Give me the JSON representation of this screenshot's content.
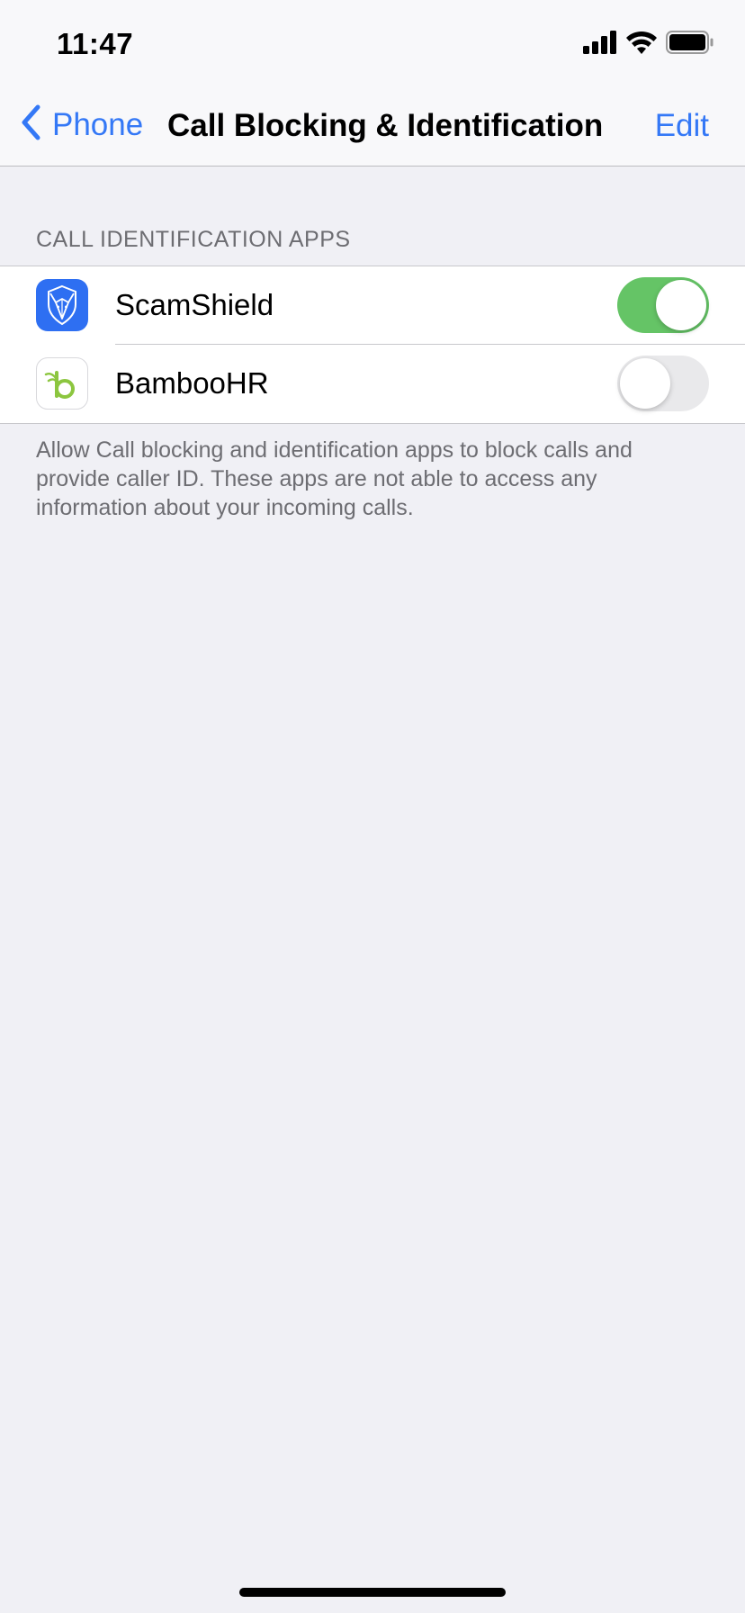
{
  "status_bar": {
    "time": "11:47"
  },
  "nav": {
    "back_label": "Phone",
    "title": "Call Blocking & Identification",
    "edit_label": "Edit"
  },
  "section": {
    "header": "CALL IDENTIFICATION APPS",
    "items": [
      {
        "label": "ScamShield",
        "icon": "scamshield-app-icon",
        "enabled": true
      },
      {
        "label": "BambooHR",
        "icon": "bamboohr-app-icon",
        "enabled": false
      }
    ],
    "footer": "Allow Call blocking and identification apps to block calls and provide caller ID. These apps are not able to access any information about your incoming calls."
  },
  "colors": {
    "accent": "#3478f6",
    "toggle_on": "#65c466",
    "toggle_off": "#e9e9eb",
    "scamshield_icon_bg": "#2e6ff2",
    "bamboohr_green": "#8cc63f"
  }
}
